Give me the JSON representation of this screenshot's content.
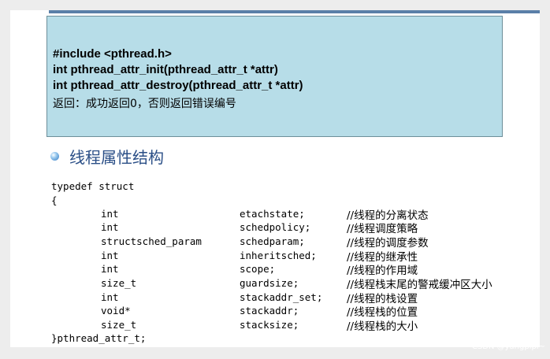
{
  "api_box": {
    "lines": [
      "#include <pthread.h>",
      "int pthread_attr_init(pthread_attr_t *attr)",
      "int pthread_attr_destroy(pthread_attr_t *attr)"
    ],
    "return_text": "返回：成功返回0，否则返回错误编号"
  },
  "section": {
    "bullet_icon": "round-bullet-icon",
    "title": "线程属性结构"
  },
  "struct_def": {
    "open_line": "typedef struct",
    "brace_open": "{",
    "fields": [
      {
        "type": "int",
        "name": "etachstate;",
        "comment": "//线程的分离状态"
      },
      {
        "type": "int",
        "name": "schedpolicy;",
        "comment": "//线程调度策略"
      },
      {
        "type": "structsched_param",
        "name": "schedparam;",
        "comment": "//线程的调度参数"
      },
      {
        "type": "int",
        "name": "inheritsched;",
        "comment": "//线程的继承性"
      },
      {
        "type": "int",
        "name": "scope;",
        "comment": "//线程的作用域"
      },
      {
        "type": "size_t",
        "name": "guardsize;",
        "comment": "//线程栈末尾的警戒缓冲区大小"
      },
      {
        "type": "int",
        "name": "stackaddr_set;",
        "comment": "//线程的栈设置"
      },
      {
        "type": "void*",
        "name": "stackaddr;",
        "comment": "//线程栈的位置"
      },
      {
        "type": "size_t",
        "name": "stacksize;",
        "comment": "//线程栈的大小"
      }
    ],
    "close_line": "}pthread_attr_t;"
  },
  "watermark": "CSDN @yangpipi~",
  "colors": {
    "box_bg": "#b7dde8",
    "heading": "#2b4f87",
    "topline": "#5a7fa8"
  }
}
